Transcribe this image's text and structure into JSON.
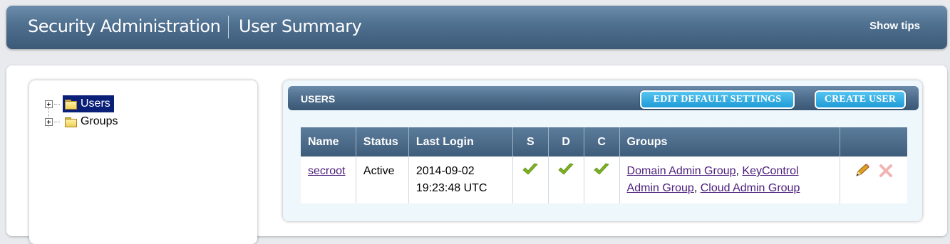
{
  "header": {
    "title": "Security Administration",
    "subtitle": "User Summary",
    "show_tips": "Show tips"
  },
  "tree": {
    "nodes": [
      {
        "label": "Users",
        "selected": true,
        "icon": "folder-icon"
      },
      {
        "label": "Groups",
        "selected": false,
        "icon": "folder-icon"
      }
    ]
  },
  "users_panel": {
    "title": "USERS",
    "edit_default_settings": "EDIT DEFAULT SETTINGS",
    "create_user": "CREATE USER",
    "columns": [
      "Name",
      "Status",
      "Last Login",
      "S",
      "D",
      "C",
      "Groups",
      ""
    ],
    "rows": [
      {
        "name": "secroot",
        "status": "Active",
        "last_login_date": "2014-09-02",
        "last_login_time": "19:23:48 UTC",
        "s": "checkmark-icon",
        "d": "checkmark-icon",
        "c": "checkmark-icon",
        "groups": [
          "Domain Admin Group",
          "KeyControl Admin Group",
          "Cloud Admin Group"
        ],
        "actions": [
          "edit-pencil-icon",
          "delete-x-icon"
        ]
      }
    ]
  },
  "colors": {
    "header_bar": "#4f6f8f",
    "selected_node": "#0a1f78",
    "button_blue": "#1f9bd6",
    "check_green": "#7db320",
    "link_purple": "#4b1c7a",
    "delete_red": "#f0b4b4"
  }
}
